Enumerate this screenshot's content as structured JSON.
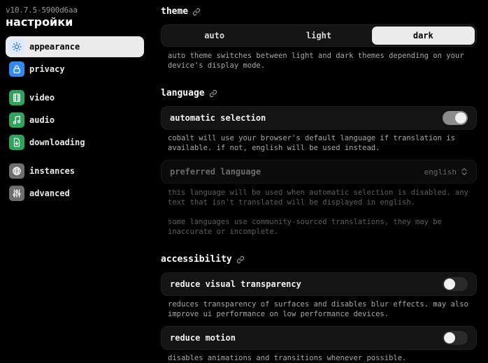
{
  "sidebar": {
    "version": "v10.7.5-5900d6aa",
    "heading": "настройки",
    "items": [
      {
        "label": "appearance",
        "icon": "appearance-icon"
      },
      {
        "label": "privacy",
        "icon": "lock-icon"
      },
      {
        "label": "video",
        "icon": "film-icon"
      },
      {
        "label": "audio",
        "icon": "music-note-icon"
      },
      {
        "label": "downloading",
        "icon": "download-file-icon"
      },
      {
        "label": "instances",
        "icon": "globe-icon"
      },
      {
        "label": "advanced",
        "icon": "sliders-icon"
      }
    ]
  },
  "theme": {
    "title": "theme",
    "options": [
      "auto",
      "light",
      "dark"
    ],
    "selected": "dark",
    "description": "auto theme switches between light and dark themes depending on your device's display mode."
  },
  "language": {
    "title": "language",
    "automatic_selection": {
      "label": "automatic selection",
      "enabled": true
    },
    "automatic_description": "cobalt will use your browser's default language if translation is available. if not, english will be used instead.",
    "preferred": {
      "label": "preferred language",
      "value": "english"
    },
    "preferred_description": "this language will be used when automatic selection is disabled. any text that isn't translated will be displayed in english.",
    "community_note": "some languages use community-sourced translations, they may be inaccurate or incomplete."
  },
  "accessibility": {
    "title": "accessibility",
    "reduce_transparency": {
      "label": "reduce visual transparency",
      "enabled": false
    },
    "transparency_description": "reduces transparency of surfaces and disables blur effects. may also improve ui performance on low performance devices.",
    "reduce_motion": {
      "label": "reduce motion",
      "enabled": false
    },
    "motion_description": "disables animations and transitions whenever possible."
  }
}
